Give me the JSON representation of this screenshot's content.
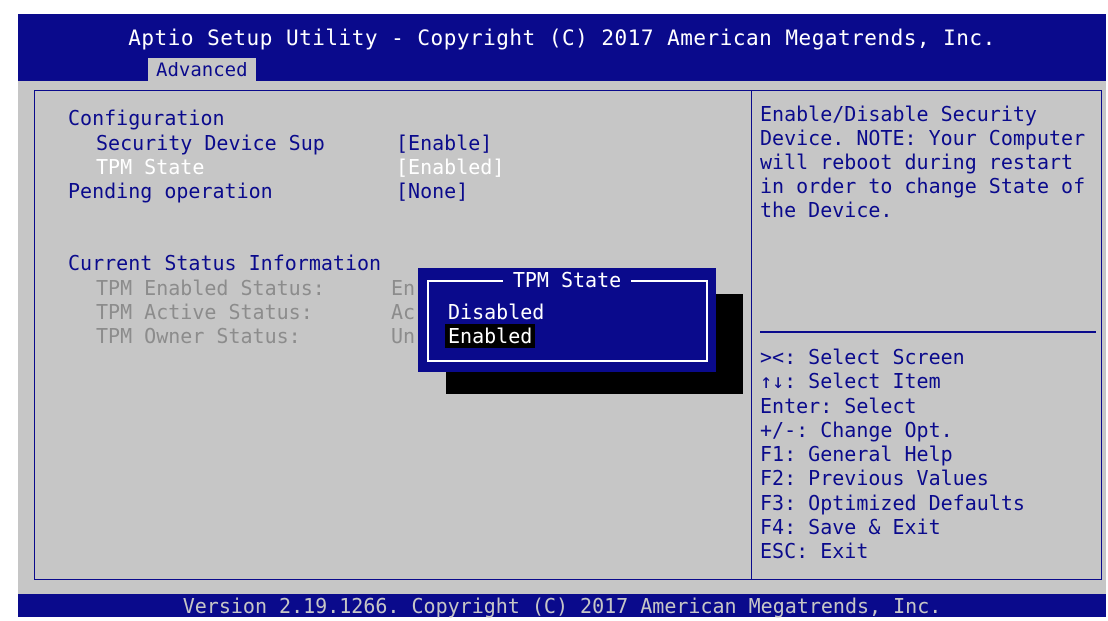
{
  "header": {
    "title": "Aptio Setup Utility - Copyright (C) 2017 American Megatrends, Inc.",
    "active_tab": "Advanced"
  },
  "main": {
    "section_title": "Configuration",
    "settings": [
      {
        "label": "Security Device Sup",
        "value": "[Enable]"
      },
      {
        "label": "TPM State",
        "value": "[Enabled]"
      },
      {
        "label": "Pending operation",
        "value": "[None]"
      }
    ],
    "status_title": "Current Status Information",
    "status": [
      {
        "label": "TPM Enabled Status:",
        "value": "En"
      },
      {
        "label": "TPM Active Status:",
        "value": "Ac"
      },
      {
        "label": "TPM Owner Status:",
        "value": "Un"
      }
    ]
  },
  "help": {
    "text": "Enable/Disable Security Device. NOTE: Your Computer will reboot during restart in order to change State of the Device."
  },
  "keys": [
    "><: Select Screen",
    "↑↓: Select Item",
    "Enter: Select",
    "+/-: Change Opt.",
    "F1: General Help",
    "F2: Previous Values",
    "F3: Optimized Defaults",
    "F4: Save & Exit",
    "ESC: Exit"
  ],
  "popup": {
    "title": "TPM State",
    "options": [
      "Disabled",
      "Enabled"
    ],
    "selected": "Enabled"
  },
  "footer": {
    "text": "Version 2.19.1266. Copyright (C) 2017 American Megatrends, Inc."
  },
  "colors": {
    "bios_blue": "#0a0a8c",
    "bios_grey": "#c6c6c6",
    "highlight_text": "#ffffff",
    "disabled_text": "#8c8c8c"
  }
}
